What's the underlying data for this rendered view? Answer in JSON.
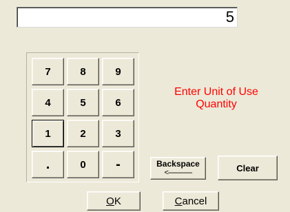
{
  "display": {
    "value": "5"
  },
  "keypad": {
    "keys": [
      "7",
      "8",
      "9",
      "4",
      "5",
      "6",
      "1",
      "2",
      "3",
      ".",
      "0",
      "-"
    ]
  },
  "prompt": {
    "line1": "Enter Unit of Use",
    "line2": "Quantity"
  },
  "buttons": {
    "backspace_label": "Backspace",
    "backspace_arrow": "<-------------",
    "clear_label": "Clear",
    "ok_mnemonic": "O",
    "ok_rest": "K",
    "cancel_mnemonic": "C",
    "cancel_rest": "ancel"
  }
}
